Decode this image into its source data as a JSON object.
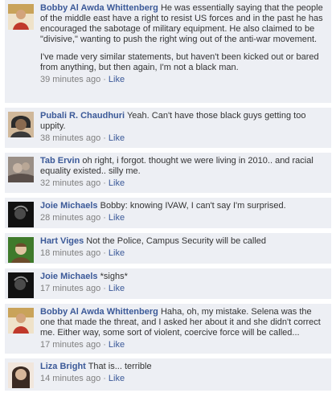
{
  "comments": [
    {
      "author": "Bobby Al Awda Whittenberg",
      "text": "He was essentially saying that the people of the middle east have a right to resist US forces and in the past he has encouraged the sabotage of military equipment. He also claimed to be \"divisive,\" wanting to push the right wing out of the anti-war movement.",
      "text2": "I've made very similar statements, but haven't been kicked out or bared from anything, but then again, I'm not a black man.",
      "time": "39 minutes ago",
      "like": "Like",
      "avatar_colors": [
        "#c9a35a",
        "#c0392b",
        "#efe2c9"
      ]
    },
    {
      "author": "Pubali R. Chaudhuri",
      "text": "Yeah. Can't have those black guys getting too uppity.",
      "time": "38 minutes ago",
      "like": "Like",
      "avatar_colors": [
        "#2b2b2b",
        "#8a6a4f",
        "#d0b89a"
      ]
    },
    {
      "author": "Tab Ervin",
      "text": "oh right, i forgot. thought we were living in 2010.. and racial equality existed.. silly me.",
      "time": "32 minutes ago",
      "like": "Like",
      "avatar_colors": [
        "#9a8f86",
        "#c8b6a6",
        "#5a4f4a"
      ]
    },
    {
      "author": "Joie Michaels",
      "text": "Bobby: knowing IVAW, I can't say I'm surprised.",
      "time": "28 minutes ago",
      "like": "Like",
      "avatar_colors": [
        "#111111",
        "#4a4a4a",
        "#8f8f8f"
      ]
    },
    {
      "author": "Hart Viges",
      "text": "Not the Police, Campus Security will be called",
      "time": "18 minutes ago",
      "like": "Like",
      "avatar_colors": [
        "#3f7a2b",
        "#e0c4a0",
        "#6b4b2a"
      ]
    },
    {
      "author": "Joie Michaels",
      "text": "*sighs*",
      "time": "17 minutes ago",
      "like": "Like",
      "avatar_colors": [
        "#111111",
        "#4a4a4a",
        "#8f8f8f"
      ]
    },
    {
      "author": "Bobby Al Awda Whittenberg",
      "text": "Haha, oh, my mistake. Selena was the one that made the threat, and I asked her about it and she didn't correct me. Either way, some sort of violent, coercive force will be called...",
      "time": "17 minutes ago",
      "like": "Like",
      "avatar_colors": [
        "#c9a35a",
        "#c0392b",
        "#efe2c9"
      ]
    },
    {
      "author": "Liza Bright",
      "text": "That is... terrible",
      "time": "14 minutes ago",
      "like": "Like",
      "avatar_colors": [
        "#3a2a22",
        "#d8b79a",
        "#f1e6dc"
      ]
    }
  ]
}
